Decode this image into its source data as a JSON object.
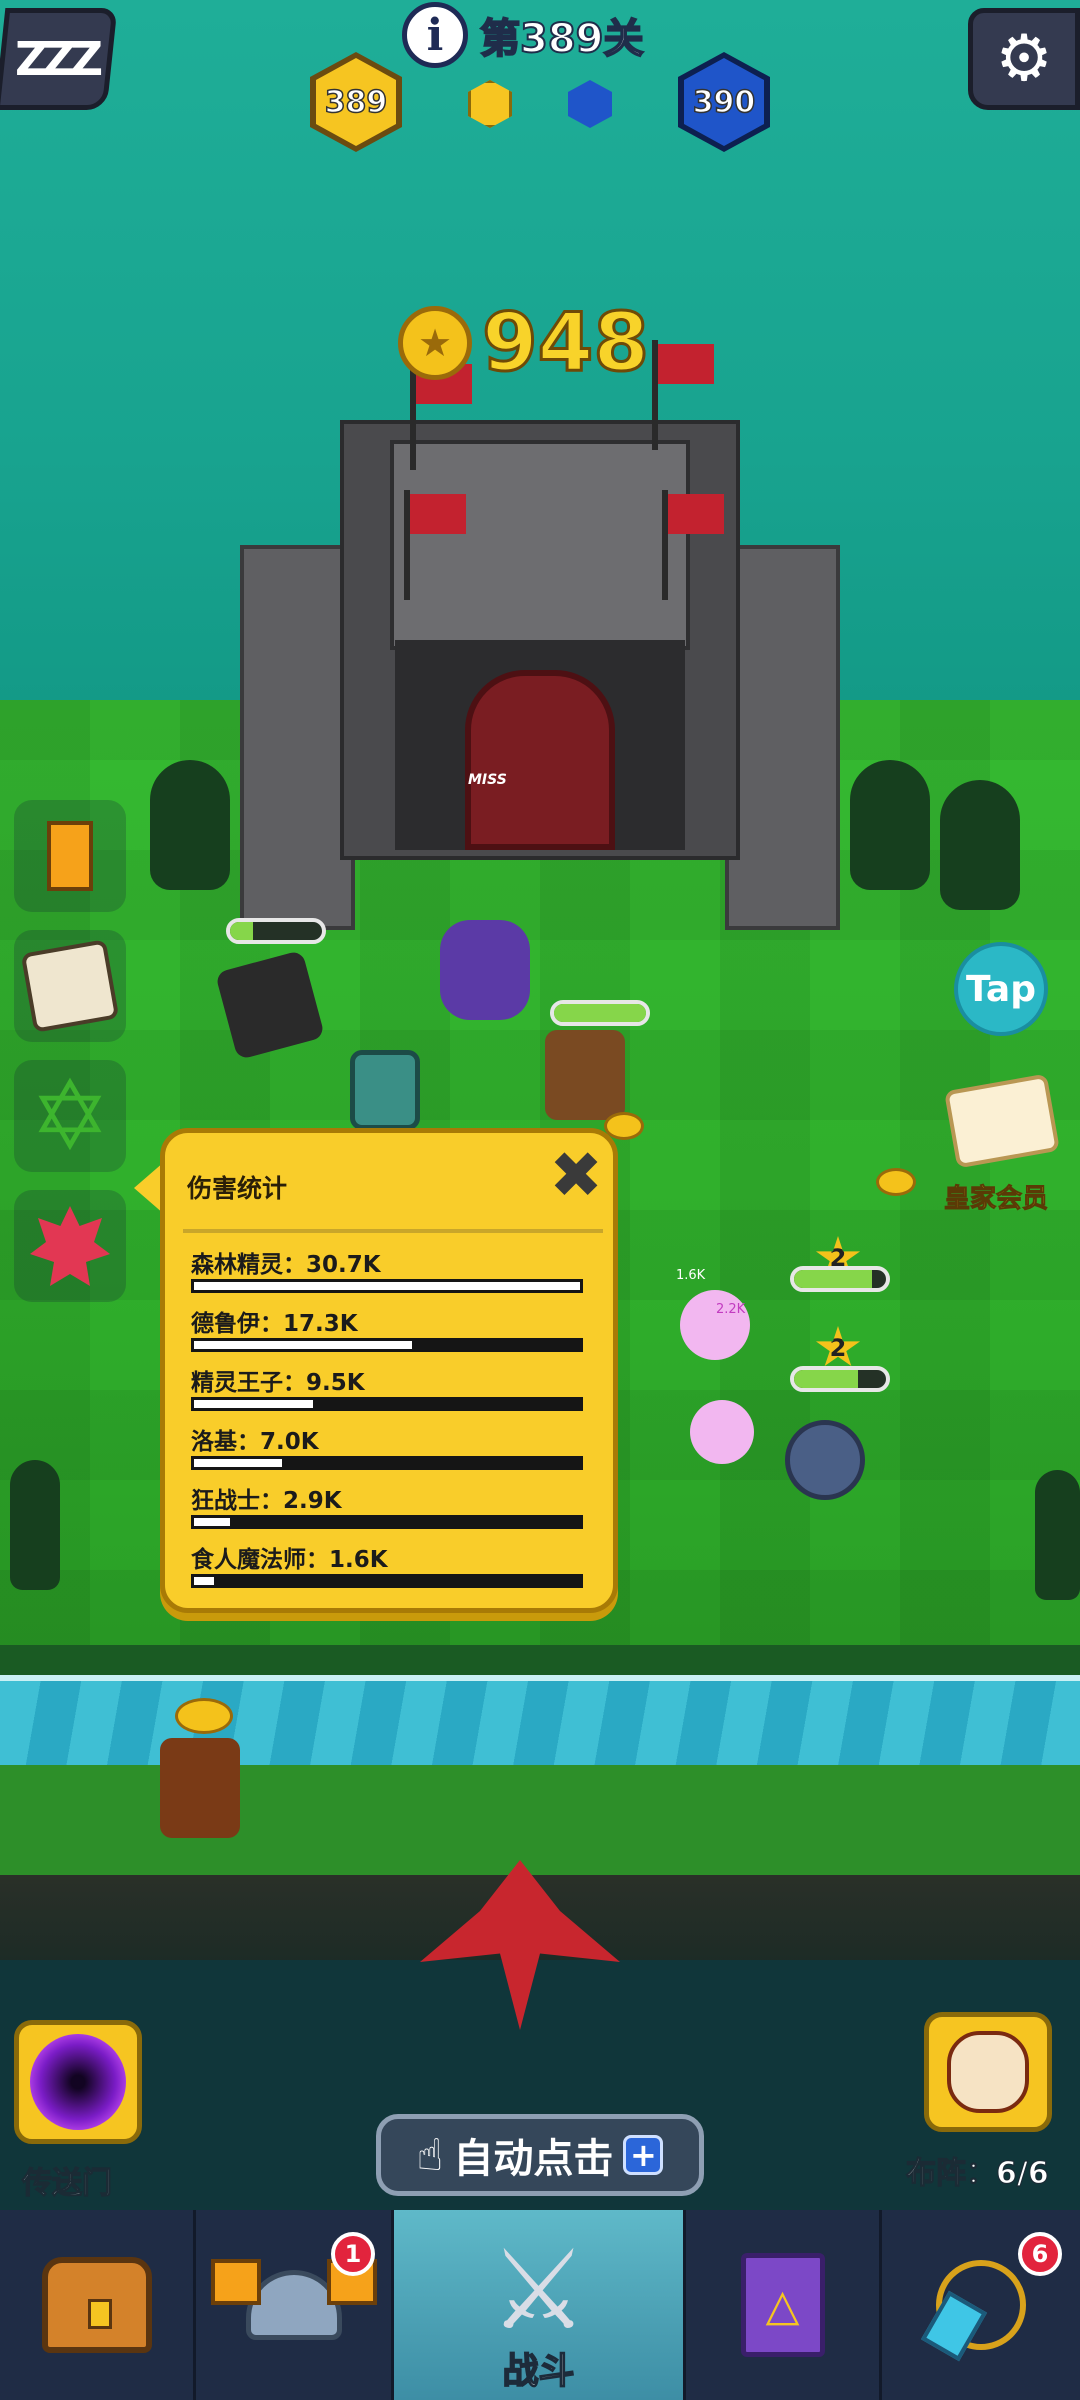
{
  "hud": {
    "sleep_icon_text": "ZZZ",
    "level_title": "第389关",
    "level_prev": "389",
    "level_next": "390",
    "gold_amount": "948"
  },
  "scene": {
    "miss_text": "MISS",
    "units": [
      {
        "name": "forest-elf-unit",
        "hp": 0.25
      },
      {
        "name": "warrior-unit",
        "hp": 1.0
      },
      {
        "name": "upper-right-enemy",
        "hp": 0.85,
        "stars": "2"
      },
      {
        "name": "lower-right-enemy",
        "hp": 0.7,
        "stars": "2"
      }
    ],
    "floating_damage": [
      "1.6K",
      "2.2K"
    ]
  },
  "side": {
    "tap_label": "Tap",
    "vip_label": "皇家会员"
  },
  "damage_panel": {
    "title": "伤害统计",
    "rows": [
      {
        "label": "森林精灵：30.7K",
        "value": 30.7
      },
      {
        "label": "德鲁伊：17.3K",
        "value": 17.3
      },
      {
        "label": "精灵王子：9.5K",
        "value": 9.5
      },
      {
        "label": "洛基：7.0K",
        "value": 7.0
      },
      {
        "label": "狂战士：2.9K",
        "value": 2.9
      },
      {
        "label": "食人魔法师：1.6K",
        "value": 1.6
      }
    ],
    "max_value": 30.7
  },
  "bottom": {
    "portal_label": "传送门",
    "formation_label": "布阵：6/6",
    "auto_tap_label": "自动点击",
    "auto_tap_plus": "+"
  },
  "nav": {
    "heroes_badge": "1",
    "battle_label": "战斗",
    "necklace_badge": "6"
  },
  "colors": {
    "accent_gold": "#f9cd2a",
    "level_blue": "#1f55c9",
    "badge_red": "#e2243d"
  }
}
